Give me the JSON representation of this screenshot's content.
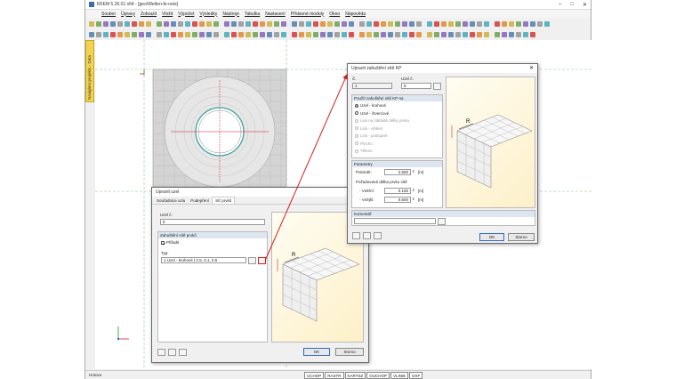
{
  "window": {
    "title": "RFEM 5.26.01 x64 - [geo/Welten-fe-nets]"
  },
  "menu": [
    "Soubor",
    "Úpravy",
    "Zobrazit",
    "Vložit",
    "Výpočet",
    "Výsledky",
    "Nástroje",
    "Tabulka",
    "Nastavení",
    "Přídavné moduly",
    "Okno",
    "Nápověda"
  ],
  "sidepanel": {
    "label": "Navigátor projektu - Data"
  },
  "status": {
    "left": "Hotovo",
    "buttons": [
      "UCHOP",
      "RASTR",
      "KARTSZ",
      "OUCHOP",
      "VLINIE",
      "DXF"
    ]
  },
  "colors": {
    "accent": "#2f6ac8",
    "arrow": "#d11f1f",
    "mesh": "#c8c8c8",
    "ring": "#3aa3a3"
  },
  "dlg1": {
    "title": "Upravit uzel",
    "tabs": [
      "Souřadnice uzlu",
      "Podepření",
      "Síť prvků"
    ],
    "node_label": "Uzel č.",
    "node_value": "5",
    "group_title": "Zahuštění sítě prvků",
    "checkbox_label": "Přiřadit",
    "type_label": "Typ:",
    "type_value": "1   Uzel - kruhové | 2.5, 0.1, 0.5",
    "ok": "OK",
    "cancel": "Storno",
    "preview_label": "R"
  },
  "dlg2": {
    "title": "Upravit zahuštění sítě KP",
    "no_label": "Č.",
    "no_value": "1",
    "nodes_label": "Uzel č.",
    "nodes_value": "5",
    "apply_group": "Použít zahuštění sítě KP na",
    "options": [
      {
        "label": "Uzel - kruhové",
        "on": true,
        "disabled": false
      },
      {
        "label": "Uzel - čtvercové",
        "on": false,
        "disabled": false
      },
      {
        "label": "Linii na základě délky prvku",
        "on": false,
        "disabled": true
      },
      {
        "label": "Linii - ošitení",
        "on": false,
        "disabled": true
      },
      {
        "label": "Linii - postupné",
        "on": false,
        "disabled": true
      },
      {
        "label": "Plochu",
        "on": false,
        "disabled": true
      },
      {
        "label": "Těleso",
        "on": false,
        "disabled": true
      }
    ],
    "params_title": "Parametry",
    "radius_label": "Poloměr:",
    "radius_value": "2.500",
    "radius_unit": "[m]",
    "req_label": "Požadovaná délka prvku sítě",
    "inner_label": "- Vnitřní:",
    "inner_value": "0.100",
    "inner_unit": "[m]",
    "outer_label": "- Vnější:",
    "outer_value": "0.500",
    "outer_unit": "[m]",
    "comment_title": "Komentář",
    "comment_value": "",
    "ok": "OK",
    "cancel": "Storno",
    "preview_label": "R"
  }
}
